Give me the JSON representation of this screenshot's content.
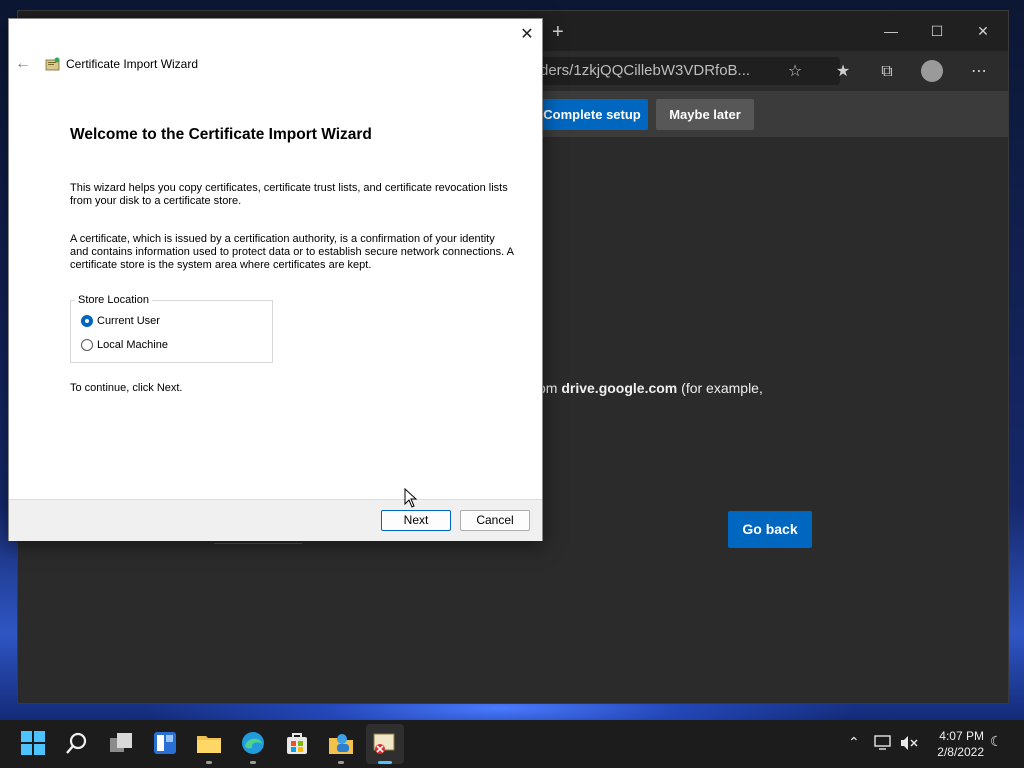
{
  "browser": {
    "new_tab": "+",
    "address": "ders/1zkjQQCillebW3VDRfoB...",
    "banner": {
      "complete_setup": "Complete setup",
      "maybe_later": "Maybe later"
    },
    "page_text_prefix": "om ",
    "page_text_bold": "drive.google.com",
    "page_text_suffix": " (for example,",
    "go_back": "Go back"
  },
  "dialog": {
    "title": "Certificate Import Wizard",
    "heading": "Welcome to the Certificate Import Wizard",
    "paragraph1": "This wizard helps you copy certificates, certificate trust lists, and certificate revocation lists from your disk to a certificate store.",
    "paragraph2": "A certificate, which is issued by a certification authority, is a confirmation of your identity and contains information used to protect data or to establish secure network connections. A certificate store is the system area where certificates are kept.",
    "store_location": {
      "legend": "Store Location",
      "options": [
        {
          "label": "Current User",
          "selected": true
        },
        {
          "label": "Local Machine",
          "selected": false
        }
      ]
    },
    "continue_text": "To continue, click Next.",
    "next": "Next",
    "cancel": "Cancel"
  },
  "taskbar": {
    "apps": [
      "start-icon",
      "search-icon",
      "task-view-icon",
      "widgets-icon",
      "file-explorer-icon",
      "edge-icon",
      "store-icon",
      "user-folder-icon",
      "certificate-app-icon"
    ],
    "time": "4:07 PM",
    "date": "2/8/2022"
  },
  "colors": {
    "accent": "#0067c0",
    "dialog_bg": "#ffffff",
    "browser_bg": "#2b2b2b",
    "taskbar_bg": "#1c1c1c"
  }
}
